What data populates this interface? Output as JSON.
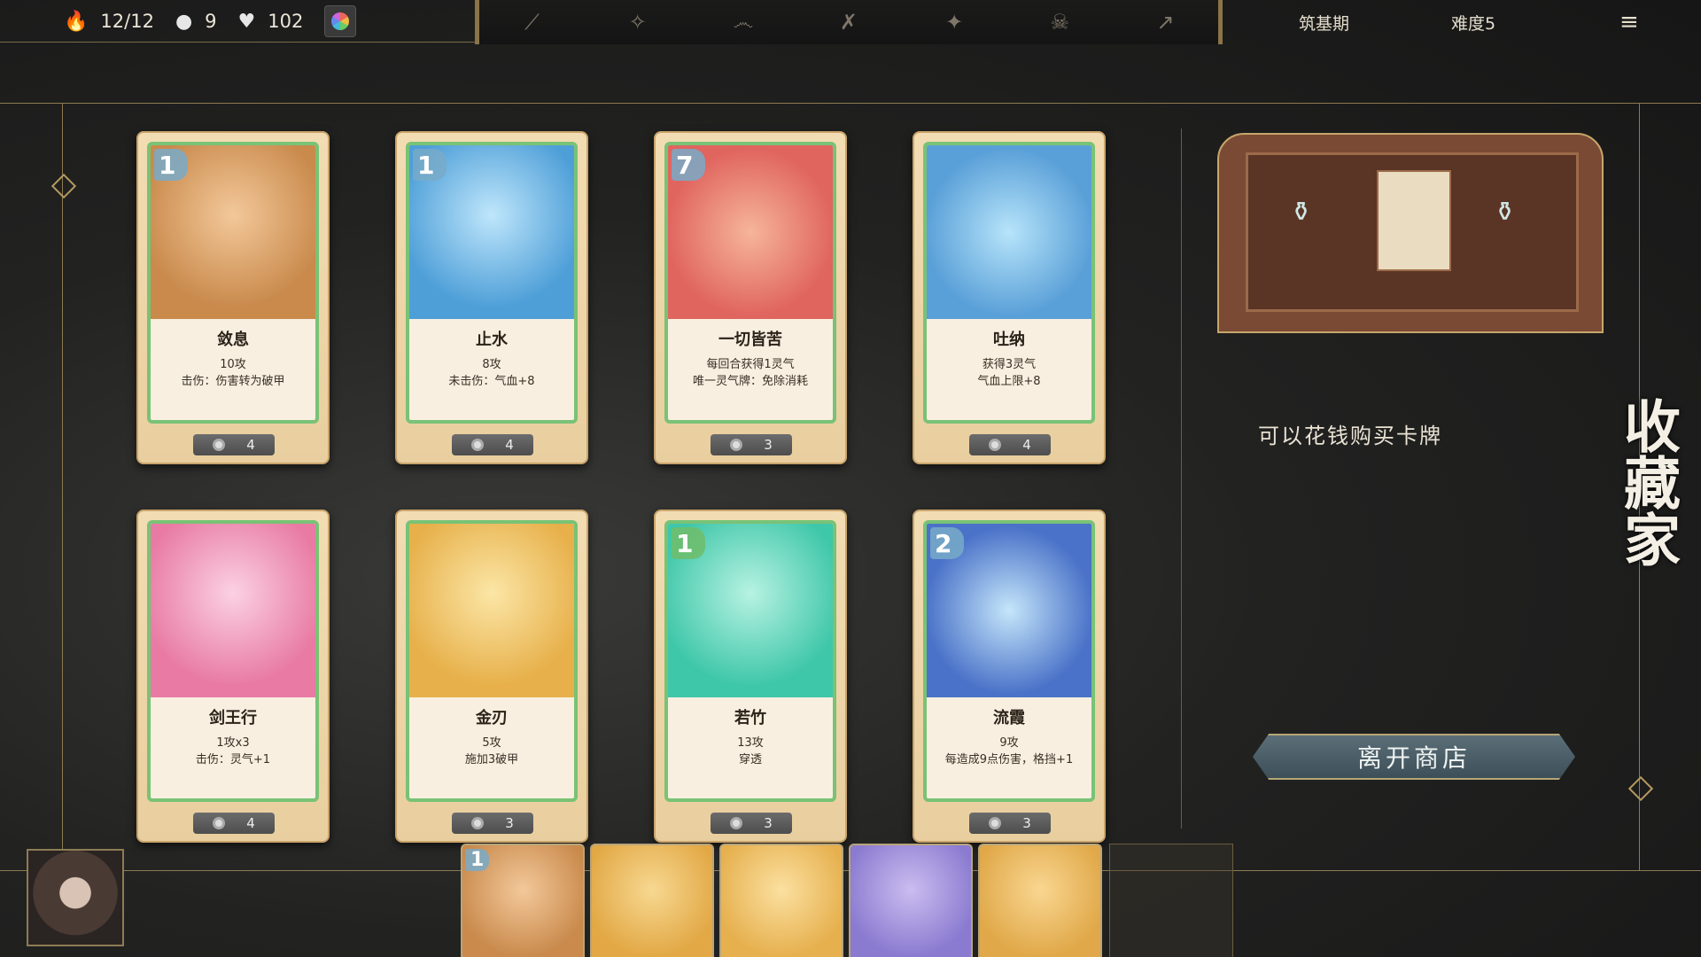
{
  "topbar": {
    "energy": "12/12",
    "coins": "9",
    "hp": "102",
    "realm": "筑基期",
    "difficulty": "难度5",
    "icons": [
      "sword-icon",
      "sparkle-icon",
      "spiral-icon",
      "crossed-swords-icon",
      "star-burst-icon",
      "skull-icon",
      "rising-arrow-icon"
    ]
  },
  "cards": [
    {
      "cost": "1",
      "name": "敛息",
      "desc1": "10攻",
      "desc2": "击伤：伤害转为破甲",
      "price": "4",
      "color": "#c98a4c"
    },
    {
      "cost": "1",
      "name": "止水",
      "desc1": "8攻",
      "desc2": "未击伤：气血+8",
      "price": "4",
      "color": "#4e9fd8"
    },
    {
      "cost": "7",
      "name": "一切皆苦",
      "desc1": "每回合获得1灵气",
      "desc2": "唯一灵气牌：免除消耗",
      "price": "3",
      "color": "#e0655f"
    },
    {
      "cost": "",
      "name": "吐纳",
      "desc1": "获得3灵气",
      "desc2": "气血上限+8",
      "price": "4",
      "color": "#5aa0d8"
    },
    {
      "cost": "",
      "name": "剑王行",
      "desc1": "1攻x3",
      "desc2": "击伤：灵气+1",
      "price": "4",
      "color": "#e87aa3"
    },
    {
      "cost": "",
      "name": "金刃",
      "desc1": "5攻",
      "desc2": "施加3破甲",
      "price": "3",
      "color": "#e7b04a"
    },
    {
      "cost": "1",
      "name": "若竹",
      "desc1": "13攻",
      "desc2": "穿透",
      "price": "3",
      "color": "#3fc7a9"
    },
    {
      "cost": "2",
      "name": "流霞",
      "desc1": "9攻",
      "desc2": "每造成9点伤害，格挡+1",
      "price": "3",
      "color": "#4a72c8"
    }
  ],
  "shop": {
    "hint": "可以花钱购买卡牌",
    "name": "收藏家",
    "leave": "离开商店"
  },
  "hand": [
    {
      "cost": "1",
      "color": "#c98a4c"
    },
    {
      "cost": "",
      "color": "#e2a845"
    },
    {
      "cost": "",
      "color": "#e6b04e"
    },
    {
      "cost": "",
      "color": "#8a7ad0"
    },
    {
      "cost": "",
      "color": "#e0a848"
    }
  ]
}
